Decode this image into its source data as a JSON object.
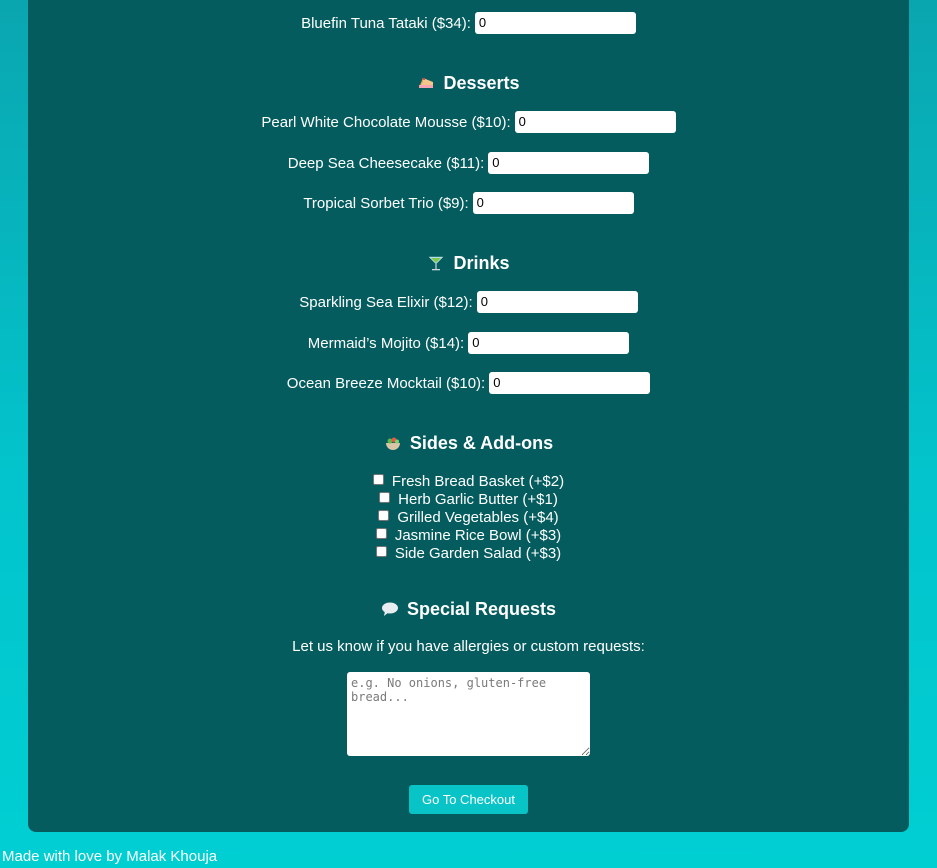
{
  "mains": {
    "items": [
      {
        "label": "Bluefin Tuna Tataki ($34):",
        "value": "0"
      }
    ]
  },
  "desserts": {
    "title": "Desserts",
    "icon": "cake-icon",
    "items": [
      {
        "label": "Pearl White Chocolate Mousse ($10):",
        "value": "0"
      },
      {
        "label": "Deep Sea Cheesecake ($11):",
        "value": "0"
      },
      {
        "label": "Tropical Sorbet Trio ($9):",
        "value": "0"
      }
    ]
  },
  "drinks": {
    "title": "Drinks",
    "icon": "cocktail-icon",
    "items": [
      {
        "label": "Sparkling Sea Elixir ($12):",
        "value": "0"
      },
      {
        "label": "Mermaid’s Mojito ($14):",
        "value": "0"
      },
      {
        "label": "Ocean Breeze Mocktail ($10):",
        "value": "0"
      }
    ]
  },
  "sides": {
    "title": "Sides & Add-ons",
    "icon": "salad-icon",
    "items": [
      {
        "label": "Fresh Bread Basket (+$2)",
        "checked": false
      },
      {
        "label": "Herb Garlic Butter (+$1)",
        "checked": false
      },
      {
        "label": "Grilled Vegetables (+$4)",
        "checked": false
      },
      {
        "label": "Jasmine Rice Bowl (+$3)",
        "checked": false
      },
      {
        "label": "Side Garden Salad (+$3)",
        "checked": false
      }
    ]
  },
  "requests": {
    "title": "Special Requests",
    "icon": "speech-bubble-icon",
    "prompt": "Let us know if you have allergies or custom requests:",
    "placeholder": "e.g. No onions, gluten-free bread...",
    "value": ""
  },
  "checkout": {
    "label": "Go To Checkout"
  },
  "footer": {
    "text": "Made with love by Malak Khouja"
  },
  "colors": {
    "panel": "#045c5e",
    "accent": "#08c4c7",
    "background": "#03c4cc"
  }
}
